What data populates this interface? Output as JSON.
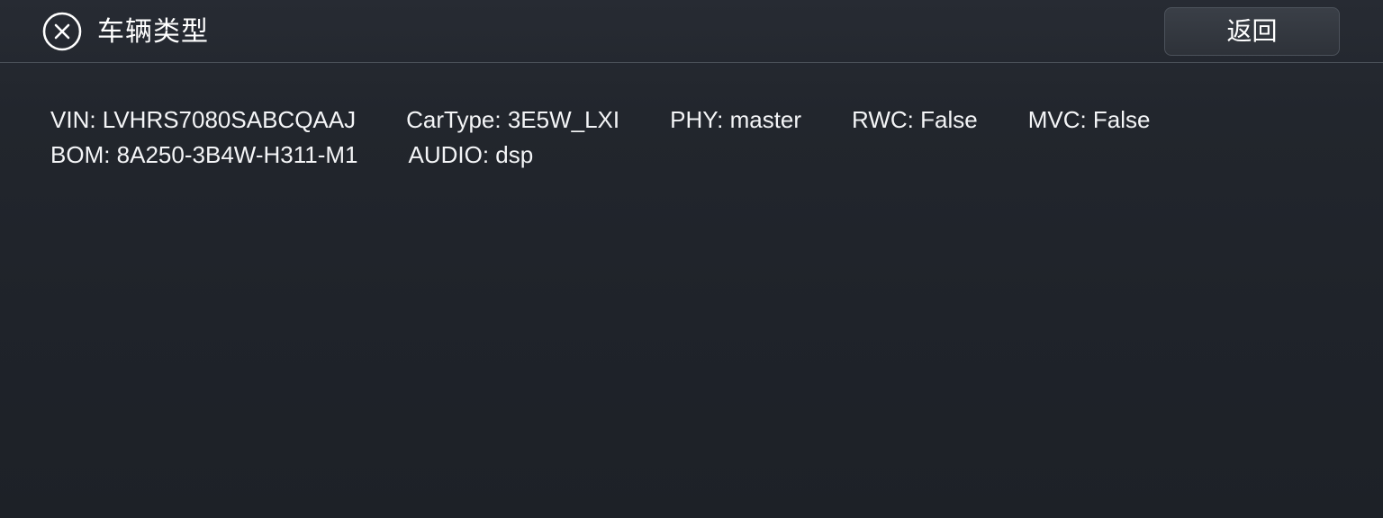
{
  "header": {
    "close_icon": "close-circle-icon",
    "title": "车辆类型",
    "back_label": "返回"
  },
  "info": {
    "row1": [
      {
        "text": "VIN: LVHRS7080SABCQAAJ"
      },
      {
        "text": "CarType: 3E5W_LXI"
      },
      {
        "text": "PHY: master"
      },
      {
        "text": "RWC: False"
      },
      {
        "text": "MVC: False"
      }
    ],
    "row2": [
      {
        "text": "BOM: 8A250-3B4W-H311-M1"
      },
      {
        "text": "AUDIO: dsp"
      }
    ]
  },
  "colors": {
    "background": "#22262d",
    "divider": "#4a5058",
    "button_bg": "#353a42",
    "text": "#ffffff"
  }
}
